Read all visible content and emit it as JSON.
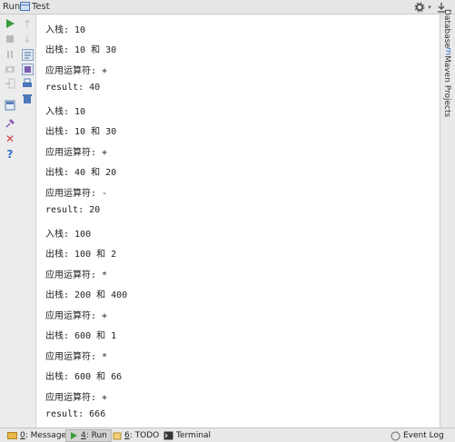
{
  "titlebar": {
    "run_label": "Run",
    "config_name": "Test"
  },
  "right_panels": {
    "database": "Database",
    "maven": "Maven Projects"
  },
  "console": {
    "lines": [
      "入栈: 10",
      "出栈: 10 和 30",
      "应用运算符: +",
      "result: 40",
      "入栈: 10",
      "出栈: 10 和 30",
      "应用运算符: +",
      "出栈: 40 和 20",
      "应用运算符: -",
      "result: 20",
      "入栈: 100",
      "出栈: 100 和 2",
      "应用运算符: *",
      "出栈: 200 和 400",
      "应用运算符: +",
      "出栈: 600 和 1",
      "应用运算符: *",
      "出栈: 600 和 66",
      "应用运算符: +",
      "result: 666"
    ]
  },
  "statusbar": {
    "messages_num": "0",
    "messages_label": ": Messages",
    "run_num": "4",
    "run_label": ": Run",
    "todo_num": "6",
    "todo_label": ": TODO",
    "terminal_label": "Terminal",
    "event_log_label": "Event Log"
  },
  "colors": {
    "run_green": "#3a9d3a",
    "stop_red": "#d64040",
    "help_blue": "#2f6fd0",
    "console_bg": "#ffffff"
  }
}
